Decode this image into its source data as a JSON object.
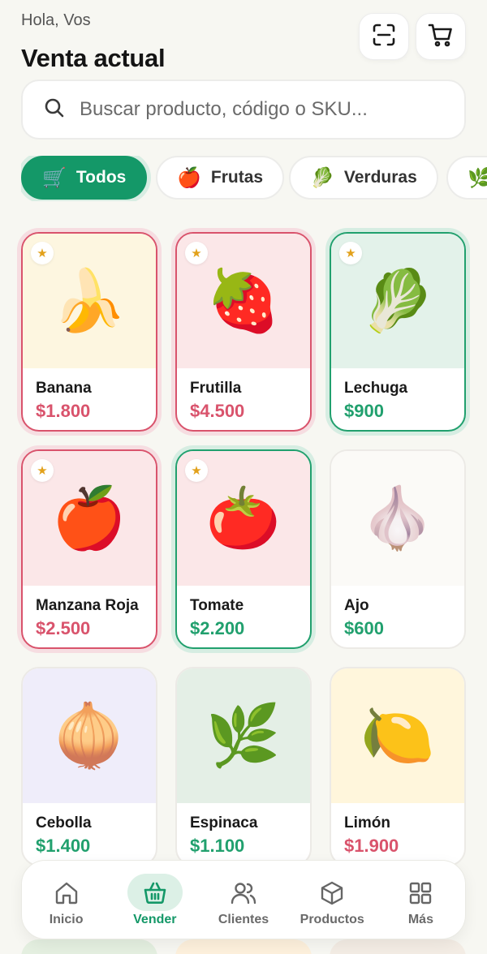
{
  "header": {
    "greeting": "Hola, Vos",
    "title": "Venta actual"
  },
  "search": {
    "placeholder": "Buscar producto, código o SKU..."
  },
  "categories": [
    {
      "emoji": "🛒",
      "label": "Todos",
      "active": true
    },
    {
      "emoji": "🍎",
      "label": "Frutas",
      "active": false
    },
    {
      "emoji": "🥬",
      "label": "Verduras",
      "active": false
    },
    {
      "emoji": "🌿",
      "label": "",
      "active": false
    }
  ],
  "products": [
    {
      "name": "Banana",
      "price": "$1.800",
      "emoji": "🍌",
      "favorite": true,
      "selected": "red",
      "price_color": "red",
      "bg": "yellow"
    },
    {
      "name": "Frutilla",
      "price": "$4.500",
      "emoji": "🍓",
      "favorite": true,
      "selected": "red",
      "price_color": "red",
      "bg": "pink"
    },
    {
      "name": "Lechuga",
      "price": "$900",
      "emoji": "🥬",
      "favorite": true,
      "selected": "green",
      "price_color": "green",
      "bg": "mint"
    },
    {
      "name": "Manzana Roja",
      "price": "$2.500",
      "emoji": "🍎",
      "favorite": true,
      "selected": "red",
      "price_color": "red",
      "bg": "pink"
    },
    {
      "name": "Tomate",
      "price": "$2.200",
      "emoji": "🍅",
      "favorite": true,
      "selected": "green",
      "price_color": "green",
      "bg": "pink"
    },
    {
      "name": "Ajo",
      "price": "$600",
      "emoji": "🧄",
      "favorite": false,
      "selected": "",
      "price_color": "green",
      "bg": "white"
    },
    {
      "name": "Cebolla",
      "price": "$1.400",
      "emoji": "🧅",
      "favorite": false,
      "selected": "",
      "price_color": "green",
      "bg": "lav"
    },
    {
      "name": "Espinaca",
      "price": "$1.100",
      "emoji": "🌿",
      "favorite": false,
      "selected": "",
      "price_color": "green",
      "bg": "sage"
    },
    {
      "name": "Limón",
      "price": "$1.900",
      "emoji": "🍋",
      "favorite": false,
      "selected": "",
      "price_color": "red",
      "bg": "cream"
    }
  ],
  "nav": [
    {
      "label": "Inicio",
      "icon": "home-icon",
      "active": false
    },
    {
      "label": "Vender",
      "icon": "basket-icon",
      "active": true
    },
    {
      "label": "Clientes",
      "icon": "users-icon",
      "active": false
    },
    {
      "label": "Productos",
      "icon": "box-icon",
      "active": false
    },
    {
      "label": "Más",
      "icon": "grid-icon",
      "active": false
    }
  ],
  "colors": {
    "accent": "#149868",
    "price_red": "#d9536c",
    "price_green": "#21a06e",
    "background": "#f7f7f2"
  }
}
